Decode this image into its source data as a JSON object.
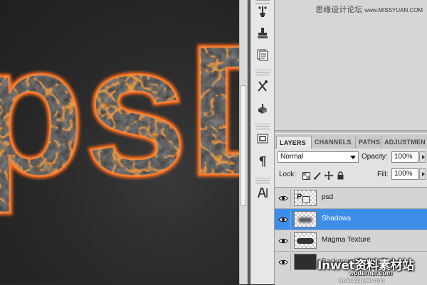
{
  "canvas": {
    "text": "psD"
  },
  "watermark": {
    "cn": "思缘设计论坛",
    "site": "www.MISSYUAN.COM"
  },
  "tools": {
    "icons": [
      "brush-preset-icon",
      "clone-source-icon",
      "history-icon",
      "tool-presets-icon",
      "3d-icon",
      "navigator-icon",
      "paragraph-icon",
      "character-icon"
    ]
  },
  "panel": {
    "tabs": [
      "LAYERS",
      "CHANNELS",
      "PATHS",
      "ADJUSTMEN"
    ],
    "blend_mode": "Normal",
    "opacity_label": "Opacity:",
    "opacity_value": "100%",
    "lock_label": "Lock:",
    "fill_label": "Fill:",
    "fill_value": "100%",
    "layers": [
      {
        "name": "psd",
        "selected": false
      },
      {
        "name": "Shadows",
        "selected": true
      },
      {
        "name": "Magma Texture",
        "selected": false
      },
      {
        "name": "Background",
        "selected": false
      }
    ]
  },
  "branding": {
    "main": "Inwet资料素材站",
    "sub": "woderner.com",
    "url": "www.52inwet.com"
  },
  "colors": {
    "selection": "#3d8ee8",
    "lava": "#ff6a1a",
    "rock": "#4a4a4a"
  }
}
